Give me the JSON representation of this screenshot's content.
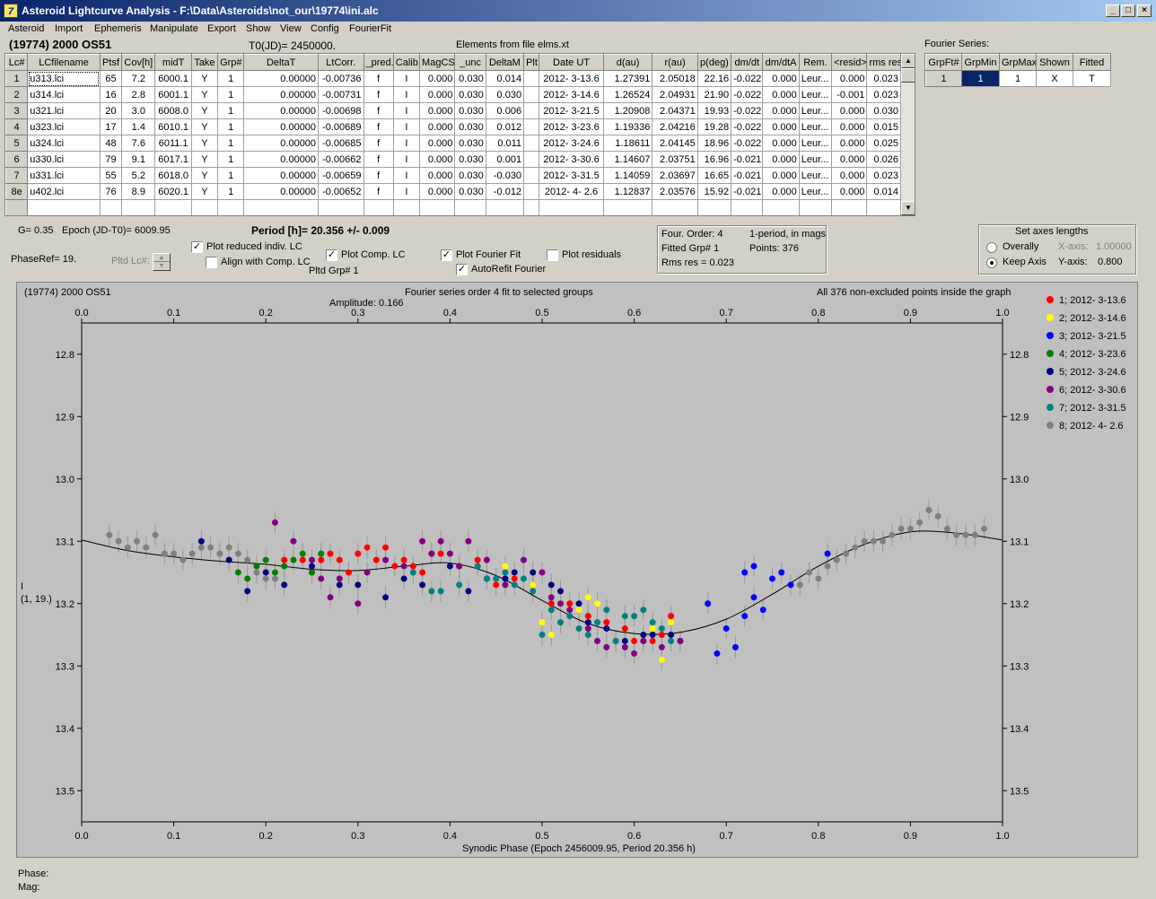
{
  "window": {
    "title": "Asteroid Lightcurve Analysis - F:\\Data\\Asteroids\\not_our\\19774\\ini.alc",
    "min_label": "_",
    "max_label": "□",
    "close_label": "×"
  },
  "menu": [
    "Asteroid",
    "Import",
    "Ephemeris",
    "Manipulate",
    "Export",
    "Show",
    "View",
    "Config",
    "FourierFit"
  ],
  "header": {
    "asteroid_name": "(19774) 2000 OS51",
    "t0": "T0(JD)= 2450000.",
    "elements": "Elements from file elms.xt"
  },
  "lc_table": {
    "columns": [
      "Lc#",
      "LCfilename",
      "Ptsf",
      "Cov[h]",
      "midT",
      "Take",
      "Grp#",
      "DeltaT",
      "LtCorr.",
      "_pred.",
      "Calib.",
      "MagCS",
      "_unc",
      "DeltaM",
      "Plt",
      "Date UT",
      "d(au)",
      "r(au)",
      "p(deg)",
      "dm/dt",
      "dm/dtA",
      "Rem.",
      "<resid>",
      "rms res"
    ],
    "rows": [
      [
        "1",
        "u313.lci",
        "65",
        "7.2",
        "6000.1",
        "Y",
        "1",
        "0.00000",
        "-0.00736",
        "f",
        "I",
        "0.000",
        "0.030",
        "0.014",
        "",
        "2012- 3-13.6",
        "1.27391",
        "2.05018",
        "22.16",
        "-0.022",
        "0.000",
        "Leur...",
        "0.000",
        "0.023"
      ],
      [
        "2",
        "u314.lci",
        "16",
        "2.8",
        "6001.1",
        "Y",
        "1",
        "0.00000",
        "-0.00731",
        "f",
        "I",
        "0.000",
        "0.030",
        "0.030",
        "",
        "2012- 3-14.6",
        "1.26524",
        "2.04931",
        "21.90",
        "-0.022",
        "0.000",
        "Leur...",
        "-0.001",
        "0.023"
      ],
      [
        "3",
        "u321.lci",
        "20",
        "3.0",
        "6008.0",
        "Y",
        "1",
        "0.00000",
        "-0.00698",
        "f",
        "I",
        "0.000",
        "0.030",
        "0.006",
        "",
        "2012- 3-21.5",
        "1.20908",
        "2.04371",
        "19.93",
        "-0.022",
        "0.000",
        "Leur...",
        "0.000",
        "0.030"
      ],
      [
        "4",
        "u323.lci",
        "17",
        "1.4",
        "6010.1",
        "Y",
        "1",
        "0.00000",
        "-0.00689",
        "f",
        "I",
        "0.000",
        "0.030",
        "0.012",
        "",
        "2012- 3-23.6",
        "1.19336",
        "2.04216",
        "19.28",
        "-0.022",
        "0.000",
        "Leur...",
        "0.000",
        "0.015"
      ],
      [
        "5",
        "u324.lci",
        "48",
        "7.6",
        "6011.1",
        "Y",
        "1",
        "0.00000",
        "-0.00685",
        "f",
        "I",
        "0.000",
        "0.030",
        "0.011",
        "",
        "2012- 3-24.6",
        "1.18611",
        "2.04145",
        "18.96",
        "-0.022",
        "0.000",
        "Leur...",
        "0.000",
        "0.025"
      ],
      [
        "6",
        "u330.lci",
        "79",
        "9.1",
        "6017.1",
        "Y",
        "1",
        "0.00000",
        "-0.00662",
        "f",
        "I",
        "0.000",
        "0.030",
        "0.001",
        "",
        "2012- 3-30.6",
        "1.14607",
        "2.03751",
        "16.96",
        "-0.021",
        "0.000",
        "Leur...",
        "0.000",
        "0.026"
      ],
      [
        "7",
        "u331.lci",
        "55",
        "5.2",
        "6018.0",
        "Y",
        "1",
        "0.00000",
        "-0.00659",
        "f",
        "I",
        "0.000",
        "0.030",
        "-0.030",
        "",
        "2012- 3-31.5",
        "1.14059",
        "2.03697",
        "16.65",
        "-0.021",
        "0.000",
        "Leur...",
        "0.000",
        "0.023"
      ],
      [
        "8e",
        "u402.lci",
        "76",
        "8.9",
        "6020.1",
        "Y",
        "1",
        "0.00000",
        "-0.00652",
        "f",
        "I",
        "0.000",
        "0.030",
        "-0.012",
        "",
        "2012- 4- 2.6",
        "1.12837",
        "2.03576",
        "15.92",
        "-0.021",
        "0.000",
        "Leur...",
        "0.000",
        "0.014"
      ]
    ]
  },
  "fourier_series": {
    "label": "Fourier Series:",
    "columns": [
      "GrpFt#",
      "GrpMin",
      "GrpMax",
      "Shown",
      "Fitted"
    ],
    "row": [
      "1",
      "1",
      "1",
      "X",
      "T"
    ]
  },
  "params": {
    "g": "G= 0.35",
    "epoch": "Epoch (JD-T0)= 6009.95",
    "period": "Period [h]= 20.356 +/- 0.009",
    "phaseref": "PhaseRef= 19.",
    "pltd_lc": "Pltd Lc#:",
    "pltd_grp": "Pltd Grp#  1"
  },
  "checkboxes": {
    "plot_reduced": {
      "label": "Plot reduced indiv. LC",
      "checked": "✓"
    },
    "align_comp": {
      "label": "Align with Comp. LC",
      "checked": ""
    },
    "plot_comp": {
      "label": "Plot Comp. LC",
      "checked": "✓"
    },
    "plot_fourier": {
      "label": "Plot Fourier Fit",
      "checked": "✓"
    },
    "autorefit": {
      "label": "AutoRefit Fourier",
      "checked": "✓"
    },
    "plot_residuals": {
      "label": "Plot residuals",
      "checked": ""
    }
  },
  "fit_info": {
    "order": "Four. Order:  4",
    "period_mags": "1-period, in mags",
    "fitted_grp": "Fitted Grp# 1",
    "points": "Points: 376",
    "rms": "Rms res      = 0.023"
  },
  "axes_box": {
    "title": "Set axes lengths",
    "overally": "Overally",
    "keep_axis": "Keep Axis",
    "xaxis_label": "X-axis:",
    "xaxis_value": "1.00000",
    "yaxis_label": "Y-axis:",
    "yaxis_value": "0.800"
  },
  "status": {
    "phase": "Phase:",
    "mag": "Mag:"
  },
  "colors": {
    "plot_bg": "#c0c0c0",
    "group_colors": [
      "#ff0000",
      "#ffff00",
      "#0000ff",
      "#008000",
      "#000080",
      "#800080",
      "#008080",
      "#808080"
    ]
  },
  "chart_data": {
    "type": "scatter",
    "title": "(19774) 2000 OS51",
    "subtitle": "Fourier series order 4 fit to selected groups",
    "amplitude": "Amplitude: 0.166",
    "note": "All 376 non-excluded points inside the graph",
    "xlabel": "Synodic Phase (Epoch 2456009.95, Period 20.356 h)",
    "ylabel": "I",
    "ylabel2": "(1, 19.)",
    "xlim": [
      0.0,
      1.0
    ],
    "ylim": [
      13.55,
      12.75
    ],
    "y_inverted": true,
    "xticks": [
      "0.0",
      "0.1",
      "0.2",
      "0.3",
      "0.4",
      "0.5",
      "0.6",
      "0.7",
      "0.8",
      "0.9",
      "1.0"
    ],
    "yticks": [
      "12.8",
      "12.9",
      "13.0",
      "13.1",
      "13.2",
      "13.3",
      "13.4",
      "13.5"
    ],
    "legend": [
      "1; 2012- 3-13.6",
      "2; 2012- 3-14.6",
      "3; 2012- 3-21.5",
      "4; 2012- 3-23.6",
      "5; 2012- 3-24.6",
      "6; 2012- 3-30.6",
      "7; 2012- 3-31.5",
      "8; 2012- 4- 2.6"
    ],
    "fourier_curve": {
      "x": [
        0.0,
        0.05,
        0.1,
        0.15,
        0.2,
        0.25,
        0.3,
        0.35,
        0.4,
        0.45,
        0.5,
        0.55,
        0.6,
        0.65,
        0.7,
        0.75,
        0.8,
        0.85,
        0.9,
        0.95,
        1.0
      ],
      "y": [
        13.098,
        13.115,
        13.125,
        13.132,
        13.137,
        13.145,
        13.147,
        13.14,
        13.135,
        13.155,
        13.195,
        13.232,
        13.248,
        13.246,
        13.225,
        13.185,
        13.14,
        13.105,
        13.085,
        13.087,
        13.098
      ]
    },
    "series": [
      {
        "name": "1; 2012- 3-13.6",
        "points": [
          [
            0.22,
            13.13
          ],
          [
            0.24,
            13.13
          ],
          [
            0.25,
            13.15
          ],
          [
            0.26,
            13.13
          ],
          [
            0.27,
            13.12
          ],
          [
            0.28,
            13.13
          ],
          [
            0.29,
            13.15
          ],
          [
            0.3,
            13.12
          ],
          [
            0.31,
            13.11
          ],
          [
            0.32,
            13.13
          ],
          [
            0.33,
            13.11
          ],
          [
            0.34,
            13.14
          ],
          [
            0.35,
            13.13
          ],
          [
            0.36,
            13.14
          ],
          [
            0.37,
            13.15
          ],
          [
            0.38,
            13.12
          ],
          [
            0.39,
            13.12
          ],
          [
            0.41,
            13.14
          ],
          [
            0.43,
            13.13
          ],
          [
            0.45,
            13.17
          ],
          [
            0.47,
            13.16
          ],
          [
            0.49,
            13.17
          ],
          [
            0.51,
            13.2
          ],
          [
            0.53,
            13.2
          ],
          [
            0.55,
            13.22
          ],
          [
            0.57,
            13.23
          ],
          [
            0.59,
            13.24
          ],
          [
            0.6,
            13.26
          ],
          [
            0.61,
            13.26
          ],
          [
            0.62,
            13.26
          ],
          [
            0.63,
            13.25
          ],
          [
            0.64,
            13.22
          ]
        ]
      },
      {
        "name": "2; 2012- 3-14.6",
        "points": [
          [
            0.46,
            13.14
          ],
          [
            0.49,
            13.17
          ],
          [
            0.5,
            13.23
          ],
          [
            0.51,
            13.25
          ],
          [
            0.54,
            13.21
          ],
          [
            0.55,
            13.19
          ],
          [
            0.56,
            13.2
          ],
          [
            0.59,
            13.22
          ],
          [
            0.62,
            13.24
          ],
          [
            0.63,
            13.29
          ],
          [
            0.64,
            13.23
          ]
        ]
      },
      {
        "name": "3; 2012- 3-21.5",
        "points": [
          [
            0.68,
            13.2
          ],
          [
            0.69,
            13.28
          ],
          [
            0.7,
            13.24
          ],
          [
            0.71,
            13.27
          ],
          [
            0.72,
            13.22
          ],
          [
            0.73,
            13.19
          ],
          [
            0.74,
            13.21
          ],
          [
            0.75,
            13.16
          ],
          [
            0.76,
            13.15
          ],
          [
            0.72,
            13.15
          ],
          [
            0.73,
            13.14
          ],
          [
            0.77,
            13.17
          ],
          [
            0.81,
            13.12
          ]
        ]
      },
      {
        "name": "4; 2012- 3-23.6",
        "points": [
          [
            0.17,
            13.15
          ],
          [
            0.18,
            13.16
          ],
          [
            0.19,
            13.14
          ],
          [
            0.2,
            13.13
          ],
          [
            0.21,
            13.15
          ],
          [
            0.22,
            13.14
          ],
          [
            0.23,
            13.13
          ],
          [
            0.24,
            13.12
          ],
          [
            0.25,
            13.15
          ],
          [
            0.26,
            13.12
          ]
        ]
      },
      {
        "name": "5; 2012- 3-24.6",
        "points": [
          [
            0.13,
            13.1
          ],
          [
            0.16,
            13.13
          ],
          [
            0.18,
            13.18
          ],
          [
            0.2,
            13.15
          ],
          [
            0.22,
            13.17
          ],
          [
            0.25,
            13.14
          ],
          [
            0.28,
            13.17
          ],
          [
            0.3,
            13.17
          ],
          [
            0.33,
            13.19
          ],
          [
            0.35,
            13.16
          ],
          [
            0.37,
            13.17
          ],
          [
            0.4,
            13.14
          ],
          [
            0.42,
            13.18
          ],
          [
            0.44,
            13.16
          ],
          [
            0.46,
            13.16
          ],
          [
            0.47,
            13.15
          ],
          [
            0.49,
            13.15
          ],
          [
            0.51,
            13.17
          ],
          [
            0.52,
            13.18
          ],
          [
            0.54,
            13.2
          ],
          [
            0.55,
            13.23
          ],
          [
            0.57,
            13.24
          ],
          [
            0.59,
            13.26
          ],
          [
            0.61,
            13.25
          ],
          [
            0.62,
            13.25
          ],
          [
            0.64,
            13.25
          ],
          [
            0.65,
            13.26
          ]
        ]
      },
      {
        "name": "6; 2012- 3-30.6",
        "points": [
          [
            0.21,
            13.07
          ],
          [
            0.23,
            13.1
          ],
          [
            0.25,
            13.13
          ],
          [
            0.26,
            13.16
          ],
          [
            0.27,
            13.19
          ],
          [
            0.28,
            13.16
          ],
          [
            0.3,
            13.2
          ],
          [
            0.31,
            13.15
          ],
          [
            0.33,
            13.13
          ],
          [
            0.35,
            13.14
          ],
          [
            0.37,
            13.1
          ],
          [
            0.38,
            13.12
          ],
          [
            0.39,
            13.1
          ],
          [
            0.4,
            13.12
          ],
          [
            0.41,
            13.14
          ],
          [
            0.42,
            13.1
          ],
          [
            0.44,
            13.13
          ],
          [
            0.46,
            13.17
          ],
          [
            0.48,
            13.13
          ],
          [
            0.5,
            13.15
          ],
          [
            0.51,
            13.19
          ],
          [
            0.52,
            13.2
          ],
          [
            0.53,
            13.21
          ],
          [
            0.55,
            13.24
          ],
          [
            0.56,
            13.26
          ],
          [
            0.57,
            13.27
          ],
          [
            0.58,
            13.26
          ],
          [
            0.59,
            13.27
          ],
          [
            0.6,
            13.28
          ],
          [
            0.61,
            13.26
          ],
          [
            0.63,
            13.27
          ],
          [
            0.65,
            13.26
          ]
        ]
      },
      {
        "name": "7; 2012- 3-31.5",
        "points": [
          [
            0.36,
            13.15
          ],
          [
            0.38,
            13.18
          ],
          [
            0.39,
            13.18
          ],
          [
            0.41,
            13.17
          ],
          [
            0.43,
            13.14
          ],
          [
            0.44,
            13.16
          ],
          [
            0.45,
            13.16
          ],
          [
            0.46,
            13.15
          ],
          [
            0.47,
            13.17
          ],
          [
            0.48,
            13.16
          ],
          [
            0.49,
            13.18
          ],
          [
            0.5,
            13.25
          ],
          [
            0.51,
            13.21
          ],
          [
            0.52,
            13.23
          ],
          [
            0.53,
            13.22
          ],
          [
            0.54,
            13.24
          ],
          [
            0.55,
            13.25
          ],
          [
            0.56,
            13.23
          ],
          [
            0.57,
            13.21
          ],
          [
            0.58,
            13.26
          ],
          [
            0.59,
            13.22
          ],
          [
            0.6,
            13.22
          ],
          [
            0.61,
            13.21
          ],
          [
            0.62,
            13.23
          ],
          [
            0.63,
            13.24
          ],
          [
            0.64,
            13.26
          ]
        ]
      },
      {
        "name": "8; 2012- 4- 2.6",
        "points": [
          [
            0.03,
            13.09
          ],
          [
            0.04,
            13.1
          ],
          [
            0.05,
            13.11
          ],
          [
            0.06,
            13.1
          ],
          [
            0.07,
            13.11
          ],
          [
            0.08,
            13.09
          ],
          [
            0.09,
            13.12
          ],
          [
            0.1,
            13.12
          ],
          [
            0.11,
            13.13
          ],
          [
            0.12,
            13.12
          ],
          [
            0.13,
            13.11
          ],
          [
            0.14,
            13.11
          ],
          [
            0.15,
            13.12
          ],
          [
            0.16,
            13.11
          ],
          [
            0.17,
            13.12
          ],
          [
            0.18,
            13.13
          ],
          [
            0.19,
            13.15
          ],
          [
            0.2,
            13.16
          ],
          [
            0.21,
            13.16
          ],
          [
            0.78,
            13.17
          ],
          [
            0.79,
            13.15
          ],
          [
            0.8,
            13.16
          ],
          [
            0.81,
            13.14
          ],
          [
            0.82,
            13.13
          ],
          [
            0.83,
            13.12
          ],
          [
            0.84,
            13.11
          ],
          [
            0.85,
            13.1
          ],
          [
            0.86,
            13.1
          ],
          [
            0.87,
            13.1
          ],
          [
            0.88,
            13.09
          ],
          [
            0.89,
            13.08
          ],
          [
            0.9,
            13.08
          ],
          [
            0.91,
            13.07
          ],
          [
            0.92,
            13.05
          ],
          [
            0.93,
            13.06
          ],
          [
            0.94,
            13.08
          ],
          [
            0.95,
            13.09
          ],
          [
            0.96,
            13.09
          ],
          [
            0.97,
            13.09
          ],
          [
            0.98,
            13.08
          ]
        ]
      }
    ]
  }
}
